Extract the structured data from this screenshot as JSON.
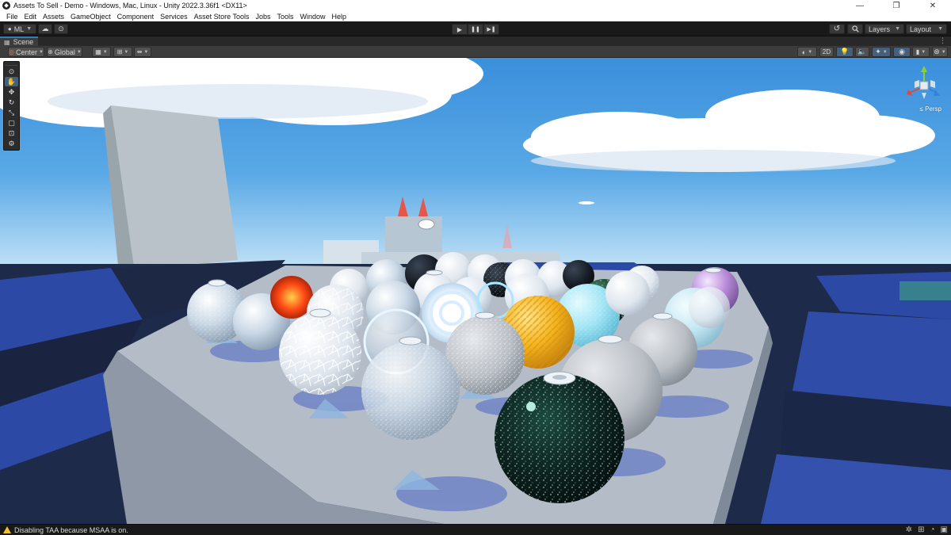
{
  "window": {
    "title": "Assets To Sell - Demo - Windows, Mac, Linux - Unity 2022.3.36f1 <DX11>",
    "controls": {
      "minimize": "—",
      "restore": "❐",
      "close": "✕"
    }
  },
  "menu": [
    "File",
    "Edit",
    "Assets",
    "GameObject",
    "Component",
    "Services",
    "Asset Store Tools",
    "Jobs",
    "Tools",
    "Window",
    "Help"
  ],
  "toolbar": {
    "account_label": "ML",
    "play_icons": [
      "▶",
      "❚❚",
      "▶❚"
    ],
    "layers_label": "Layers",
    "layout_label": "Layout"
  },
  "scene_tab": {
    "label": "Scene",
    "menu_glyph": "⋮"
  },
  "scene_toolbar": {
    "pivot_label": "Center",
    "space_label": "Global",
    "mode_2d_label": "2D"
  },
  "tools": [
    "view",
    "hand",
    "move",
    "rotate",
    "scale",
    "rect",
    "transform",
    "custom"
  ],
  "gizmo": {
    "projection_label": "Persp",
    "axis_colors": {
      "x": "#e0483a",
      "y": "#8ccd3c",
      "z": "#3a7fe0"
    }
  },
  "status": {
    "message": "Disabling TAA because MSAA is on.",
    "warning_color": "#f2c12e"
  },
  "colors": {
    "accent": "#3a79bb",
    "sky_top": "#3a8fdc",
    "sky_horizon": "#cfe9f8",
    "floor_blue": "#2c49a6",
    "floor_dark": "#1e2a4a"
  }
}
